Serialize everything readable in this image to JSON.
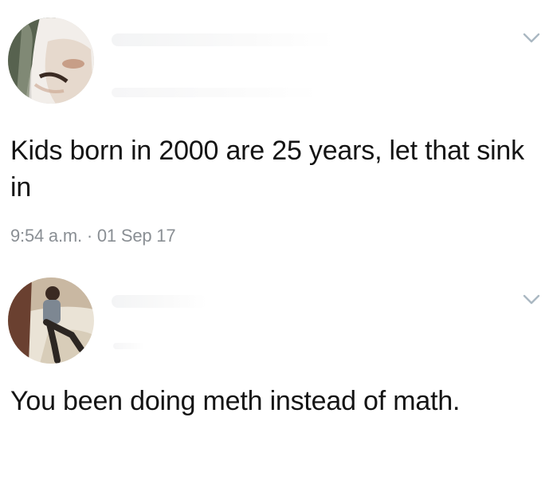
{
  "tweets": [
    {
      "avatar": "user-avatar-face-closeup",
      "text": "Kids born in 2000 are 25 years, let that sink in",
      "timestamp": "9:54 a.m. · 01 Sep 17",
      "menu_icon": "chevron-down-icon"
    },
    {
      "avatar": "user-avatar-seated-man",
      "text": "You been doing meth instead of math.",
      "menu_icon": "chevron-down-icon"
    }
  ],
  "colors": {
    "text": "#141414",
    "timestamp": "#8a8f94",
    "chevron": "#aab8c2",
    "background": "#ffffff"
  }
}
